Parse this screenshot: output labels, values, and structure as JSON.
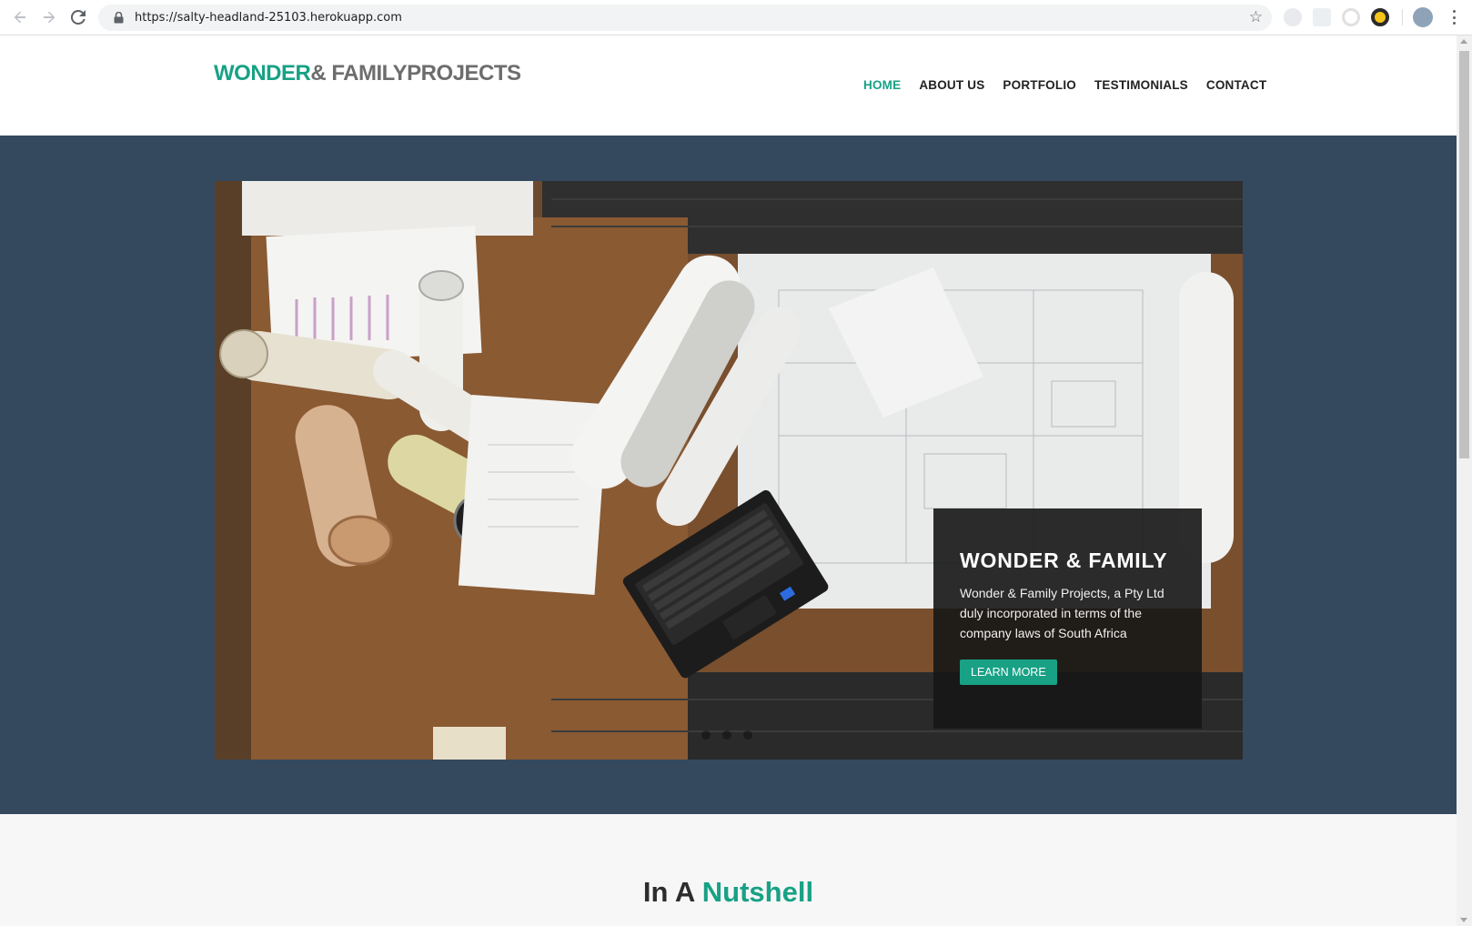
{
  "browser": {
    "url": "https://salty-headland-25103.herokuapp.com",
    "back_icon": "arrow-left-icon",
    "forward_icon": "arrow-right-icon",
    "reload_icon": "reload-icon",
    "bookmark_icon": "star-icon"
  },
  "site": {
    "logo_part1": "WONDER",
    "logo_part2": "& FAMILYPROJECTS",
    "accent_color": "#18a185",
    "nav": [
      {
        "label": "HOME",
        "active": true
      },
      {
        "label": "ABOUT US",
        "active": false
      },
      {
        "label": "PORTFOLIO",
        "active": false
      },
      {
        "label": "TESTIMONIALS",
        "active": false
      },
      {
        "label": "CONTACT",
        "active": false
      }
    ]
  },
  "hero": {
    "background_color": "#34495e",
    "caption_title": "WONDER & FAMILY",
    "caption_text": "Wonder & Family Projects, a Pty Ltd duly incorporated in terms of the company laws of South Africa",
    "button_label": "LEARN MORE",
    "slide_count": 3
  },
  "section": {
    "title_part1": "In A",
    "title_part2": "Nutshell"
  }
}
